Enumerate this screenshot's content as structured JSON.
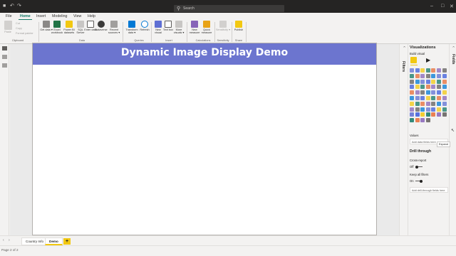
{
  "search": {
    "placeholder": "Search"
  },
  "menu_tabs": [
    "File",
    "Home",
    "Insert",
    "Modeling",
    "View",
    "Help"
  ],
  "ribbon": {
    "clipboard": {
      "paste": "Paste",
      "cut": "Cut",
      "copy": "Copy",
      "format_painter": "Format painter",
      "group": "Clipboard"
    },
    "data": {
      "buttons": [
        "Get data ▾",
        "Excel workbook",
        "Power BI datasets",
        "SQL Server",
        "Enter data",
        "Dataverse",
        "Recent sources ▾"
      ],
      "group": "Data"
    },
    "queries": {
      "buttons": [
        "Transform data ▾",
        "Refresh"
      ],
      "group": "Queries"
    },
    "insert": {
      "buttons": [
        "New visual",
        "Text box",
        "More visuals ▾"
      ],
      "group": "Insert"
    },
    "calculations": {
      "buttons": [
        "New measure",
        "Quick measure"
      ],
      "group": "Calculations"
    },
    "sensitivity": {
      "buttons": [
        "Sensitivity ▾"
      ],
      "group": "Sensitivity"
    },
    "share": {
      "buttons": [
        "Publish"
      ],
      "group": "Share"
    }
  },
  "canvas": {
    "title": "Dynamic Image Display Demo"
  },
  "filters_label": "Filters",
  "fields_label": "Fields",
  "viz_pane": {
    "title": "Visualizations",
    "build_visual": "Build visual",
    "values_label": "Values",
    "add_fields_placeholder": "Add data fields here",
    "drill_through": "Drill through",
    "cross_report": "Cross-report",
    "cross_report_state": "Off",
    "keep_all_filters": "Keep all filters",
    "keep_all_filters_state": "On",
    "add_drill_fields": "Add drill-through fields here",
    "tooltip": "Expand"
  },
  "page_tabs": [
    "Country Info",
    "Demo"
  ],
  "active_page_tab": "Demo",
  "status": {
    "page_text": "Page 2 of 2"
  },
  "colors": {
    "accent": "#117865",
    "title_band": "#6c75cf",
    "page_tab_highlight": "#f2c811",
    "titlebar": "#252423"
  }
}
